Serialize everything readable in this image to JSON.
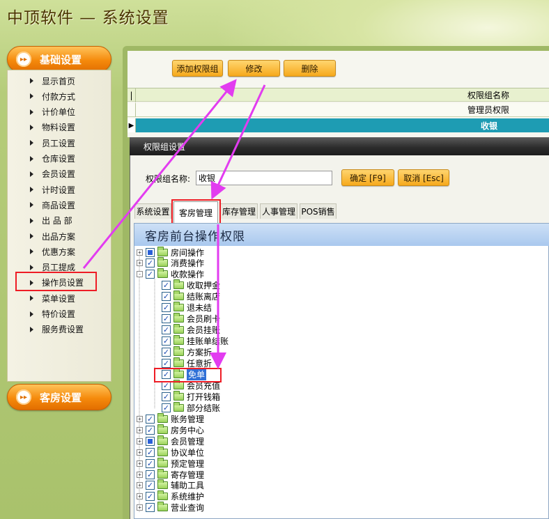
{
  "app_title": "中顶软件 — 系统设置",
  "nav": {
    "section1": "基础设置",
    "section2": "客房设置",
    "items": [
      "显示首页",
      "付款方式",
      "计价单位",
      "物料设置",
      "员工设置",
      "仓库设置",
      "会员设置",
      "计时设置",
      "商品设置",
      "出 品 部",
      "出品方案",
      "优惠方案",
      "员工提成",
      "操作员设置",
      "菜单设置",
      "特价设置",
      "服务费设置"
    ]
  },
  "toolbar": {
    "add": "添加权限组",
    "edit": "修改",
    "delete": "删除"
  },
  "grid": {
    "header": "权限组名称",
    "rows": [
      "管理员权限",
      "收银"
    ]
  },
  "dialog": {
    "title": "权限组设置",
    "name_label": "权限组名称:",
    "name_value": "收银",
    "ok": "确定 [F9]",
    "cancel": "取消 [Esc]",
    "tabs": [
      "系统设置",
      "客房管理",
      "库存管理",
      "人事管理",
      "POS销售"
    ],
    "tree_title": "客房前台操作权限",
    "tree": {
      "top_before": [
        "房间操作",
        "消费操作",
        "收款操作"
      ],
      "children": [
        "收取押金",
        "结账离店",
        "退未结",
        "会员刷卡",
        "会员挂账",
        "挂账单结账",
        "方案折",
        "任意折",
        "免单",
        "会员充值",
        "打开钱箱",
        "部分结账"
      ],
      "top_after": [
        "账务管理",
        "房务中心",
        "会员管理",
        "协议单位",
        "预定管理",
        "寄存管理",
        "辅助工具",
        "系统维护",
        "营业查询"
      ]
    }
  },
  "colors": {
    "accent_orange": "#f58a0c",
    "selected_row": "#1e9cb3",
    "annotation": "#ee1c25",
    "arrow": "#e23cf0"
  }
}
